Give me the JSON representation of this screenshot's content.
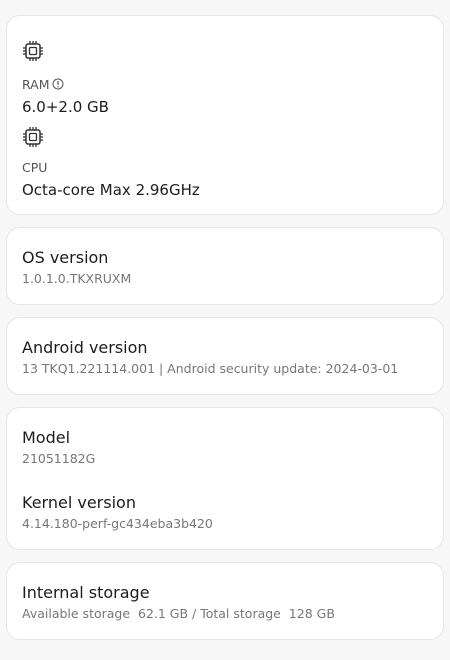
{
  "hardware": {
    "ram": {
      "label": "RAM",
      "value": "6.0+2.0 GB",
      "icon": "chip-icon",
      "info_icon": "info-icon"
    },
    "cpu": {
      "label": "CPU",
      "value": "Octa-core Max 2.96GHz",
      "icon": "chip-icon"
    }
  },
  "os_version": {
    "title": "OS version",
    "value": "1.0.1.0.TKXRUXM"
  },
  "android_version": {
    "title": "Android version",
    "value": "13 TKQ1.221114.001 | Android security update: 2024-03-01"
  },
  "model": {
    "title": "Model",
    "value": "21051182G"
  },
  "kernel": {
    "title": "Kernel version",
    "value": "4.14.180-perf-gc434eba3b420"
  },
  "storage": {
    "title": "Internal storage",
    "value": "Available storage  62.1 GB / Total storage  128 GB"
  }
}
